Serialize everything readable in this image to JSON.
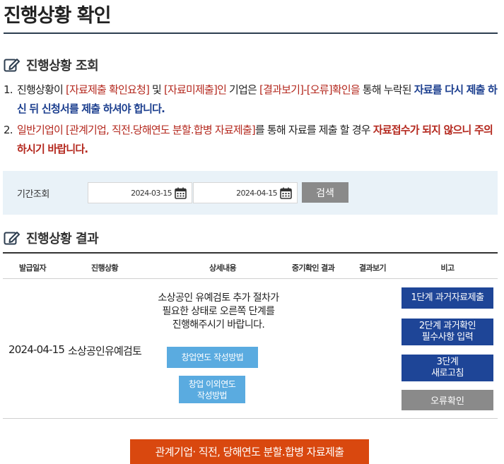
{
  "page": {
    "title": "진행상황 확인"
  },
  "section1": {
    "title": "진행상황 조회"
  },
  "notes": {
    "n1": {
      "num": "1.",
      "t1": "진행상황이 ",
      "r1": "[자료제출 확인요청]",
      "t2": " 및 ",
      "r2": "[자료미제출]인",
      "t3": " 기업은 ",
      "r3": "[결과보기]-[오류]확인을",
      "t4": " 통해 누락된 ",
      "b1": "자료를 다시 제출 하신 뒤 신청서를 제출 하셔야 합니다."
    },
    "n2": {
      "num": "2.",
      "r1": "일반기업이 [관계기업, 직전.당해연도 분할.합병 자료제출]",
      "t1": "를 통해 자료를 제출 할 경우 ",
      "r2": "자료접수가 되지 않으니 주의하시기 바랍니다."
    }
  },
  "filter": {
    "label": "기간조회",
    "start_date": "2024-03-15",
    "end_date": "2024-04-15",
    "search_label": "검색"
  },
  "section2": {
    "title": "진행상황 결과"
  },
  "table": {
    "headers": [
      "발급일자",
      "진행상황",
      "상세내용",
      "중기확인 결과",
      "결과보기",
      "비고"
    ],
    "row": {
      "date": "2024-04-15",
      "status": "소상공인유예검토",
      "detail_line1": "소상공인 유예검토 추가 절차가",
      "detail_line2": "필요한 상태로 오른쪽 단계를",
      "detail_line3": "진행해주시기 바랍니다.",
      "btn_method": "창업연도 작성방법",
      "btn_other_line1": "창업 이외연도",
      "btn_other_line2": "작성방법",
      "step1": "1단계 과거자료제출",
      "step2_line1": "2단계 과거확인",
      "step2_line2": "필수사항 입력",
      "step3_line1": "3단계",
      "step3_line2": "새로고침",
      "error_check": "오류확인"
    }
  },
  "bottom_button": "관계기업· 직전, 당해연도 분할.합병 자료제출",
  "colors": {
    "accent_red": "#b4281e",
    "accent_blue": "#1c3f8f",
    "step_blue": "#1e4597",
    "bottom_orange": "#d9480f",
    "sky": "#5aabe0"
  },
  "icons": {
    "section": "edit-icon",
    "date": "calendar-icon"
  }
}
